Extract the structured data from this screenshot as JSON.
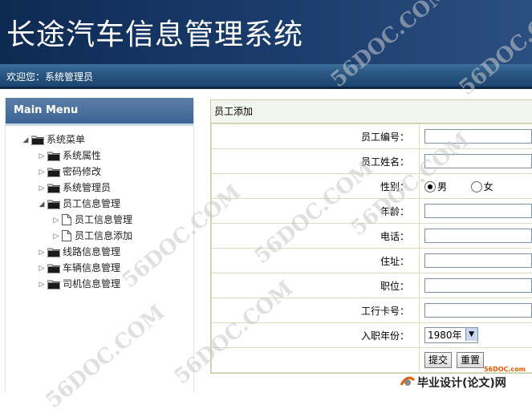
{
  "header": {
    "title": "长途汽车信息管理系统"
  },
  "welcome": {
    "text": "欢迎您：系统管理员"
  },
  "sidebar": {
    "title": "Main Menu",
    "items": [
      {
        "label": "系统菜单",
        "level": 0,
        "expanded": true,
        "type": "folder"
      },
      {
        "label": "系统属性",
        "level": 1,
        "expanded": false,
        "type": "folder"
      },
      {
        "label": "密码修改",
        "level": 1,
        "expanded": false,
        "type": "folder"
      },
      {
        "label": "系统管理员",
        "level": 1,
        "expanded": false,
        "type": "folder"
      },
      {
        "label": "员工信息管理",
        "level": 1,
        "expanded": true,
        "type": "folder"
      },
      {
        "label": "员工信息管理",
        "level": 2,
        "expanded": false,
        "type": "doc"
      },
      {
        "label": "员工信息添加",
        "level": 2,
        "expanded": false,
        "type": "doc"
      },
      {
        "label": "线路信息管理",
        "level": 1,
        "expanded": false,
        "type": "folder"
      },
      {
        "label": "车辆信息管理",
        "level": 1,
        "expanded": false,
        "type": "folder"
      },
      {
        "label": "司机信息管理",
        "level": 1,
        "expanded": false,
        "type": "folder"
      }
    ]
  },
  "form": {
    "title": "员工添加",
    "fields": {
      "emp_no": {
        "label": "员工编号：",
        "value": ""
      },
      "emp_name": {
        "label": "员工姓名：",
        "value": ""
      },
      "gender": {
        "label": "性别：",
        "options": [
          "男",
          "女"
        ],
        "selected": "男"
      },
      "age": {
        "label": "年龄：",
        "value": ""
      },
      "phone": {
        "label": "电话：",
        "value": ""
      },
      "address": {
        "label": "住址：",
        "value": ""
      },
      "position": {
        "label": "职位：",
        "value": ""
      },
      "salary_card": {
        "label": "工行卡号：",
        "value": ""
      },
      "join_year": {
        "label": "入职年份：",
        "value": "1980年"
      }
    },
    "submit_label": "提交",
    "reset_label": "重置"
  },
  "watermark": {
    "text": "56DOC.COM"
  },
  "footer_logo": {
    "small": "56DOC.com",
    "text": "毕业设计(论文)网"
  },
  "colors": {
    "header_bg": "#1b3d6e",
    "panel_border": "#c5d0a6",
    "footer_accent": "#e05a00"
  }
}
